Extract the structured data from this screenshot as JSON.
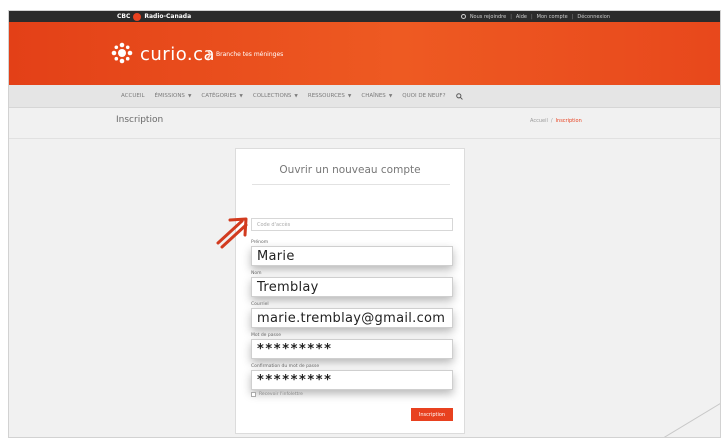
{
  "topbar": {
    "brand": "CBC",
    "brand_sub": "Radio-Canada",
    "links": [
      "Nous rejoindre",
      "Aide",
      "Mon compte",
      "Déconnexion"
    ]
  },
  "banner": {
    "site_name": "curio.ca",
    "slogan": "Branche tes méninges"
  },
  "nav": {
    "items": [
      {
        "label": "ACCUEIL",
        "dropdown": false
      },
      {
        "label": "ÉMISSIONS",
        "dropdown": true
      },
      {
        "label": "CATÉGORIES",
        "dropdown": true
      },
      {
        "label": "COLLECTIONS",
        "dropdown": true
      },
      {
        "label": "RESSOURCES",
        "dropdown": true
      },
      {
        "label": "CHAÎNES",
        "dropdown": true
      },
      {
        "label": "QUOI DE NEUF?",
        "dropdown": false
      }
    ],
    "search_icon": "search-icon"
  },
  "page": {
    "title": "Inscription",
    "breadcrumb": {
      "home": "Accueil",
      "separator": "/",
      "current": "Inscription"
    }
  },
  "form": {
    "title": "Ouvrir un nouveau compte",
    "access_code": {
      "placeholder": "Code d'accès",
      "value": ""
    },
    "first_name": {
      "label": "Prénom",
      "value": "Marie"
    },
    "last_name": {
      "label": "Nom",
      "value": "Tremblay"
    },
    "email": {
      "label": "Courriel",
      "value": "marie.tremblay@gmail.com"
    },
    "password": {
      "label": "Mot de passe",
      "value": "*********"
    },
    "password_confirm": {
      "label": "Confirmation du mot de passe",
      "value": "*********"
    },
    "remember": {
      "label": "Recevoir l'infolettre",
      "checked": false
    },
    "submit_label": "Inscription"
  },
  "colors": {
    "brand": "#e8411f",
    "banner_end": "#ee5a22",
    "topbar": "#2b2b2b"
  }
}
